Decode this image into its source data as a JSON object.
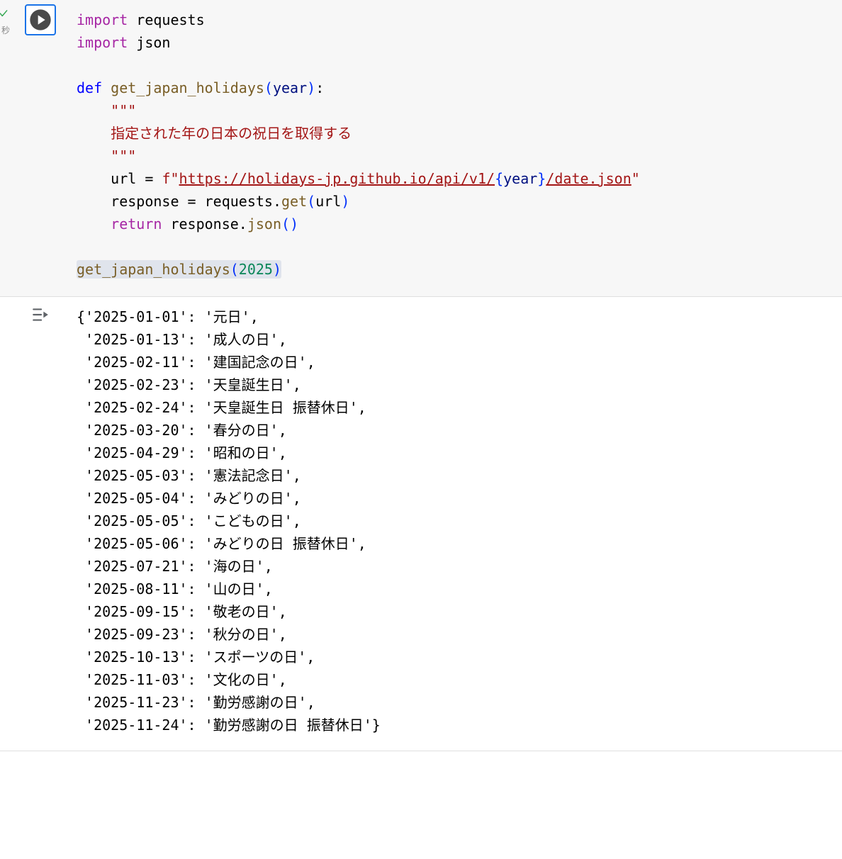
{
  "gutter": {
    "seconds_label": "秒"
  },
  "code": {
    "kw_import": "import",
    "mod_requests": "requests",
    "mod_json": "json",
    "kw_def": "def",
    "func_name": "get_japan_holidays",
    "paren_open": "(",
    "param_year": "year",
    "paren_close": ")",
    "colon": ":",
    "docq": "\"\"\"",
    "docstring_body": "指定された年の日本の祝日を取得する",
    "var_url": "url",
    "eq": "=",
    "f_prefix": "f",
    "dq": "\"",
    "url_part1": "https://holidays-jp.github.io/api/v1/",
    "brace_open": "{",
    "brace_close": "}",
    "url_part2": "/date.json",
    "var_response": "response",
    "requests_get_mod": "requests",
    "dot": ".",
    "get_fn": "get",
    "kw_return": "return",
    "json_fn": "json",
    "call_year": "2025"
  },
  "output": [
    "{'2025-01-01': '元日',",
    " '2025-01-13': '成人の日',",
    " '2025-02-11': '建国記念の日',",
    " '2025-02-23': '天皇誕生日',",
    " '2025-02-24': '天皇誕生日 振替休日',",
    " '2025-03-20': '春分の日',",
    " '2025-04-29': '昭和の日',",
    " '2025-05-03': '憲法記念日',",
    " '2025-05-04': 'みどりの日',",
    " '2025-05-05': 'こどもの日',",
    " '2025-05-06': 'みどりの日 振替休日',",
    " '2025-07-21': '海の日',",
    " '2025-08-11': '山の日',",
    " '2025-09-15': '敬老の日',",
    " '2025-09-23': '秋分の日',",
    " '2025-10-13': 'スポーツの日',",
    " '2025-11-03': '文化の日',",
    " '2025-11-23': '勤労感謝の日',",
    " '2025-11-24': '勤労感謝の日 振替休日'}"
  ]
}
